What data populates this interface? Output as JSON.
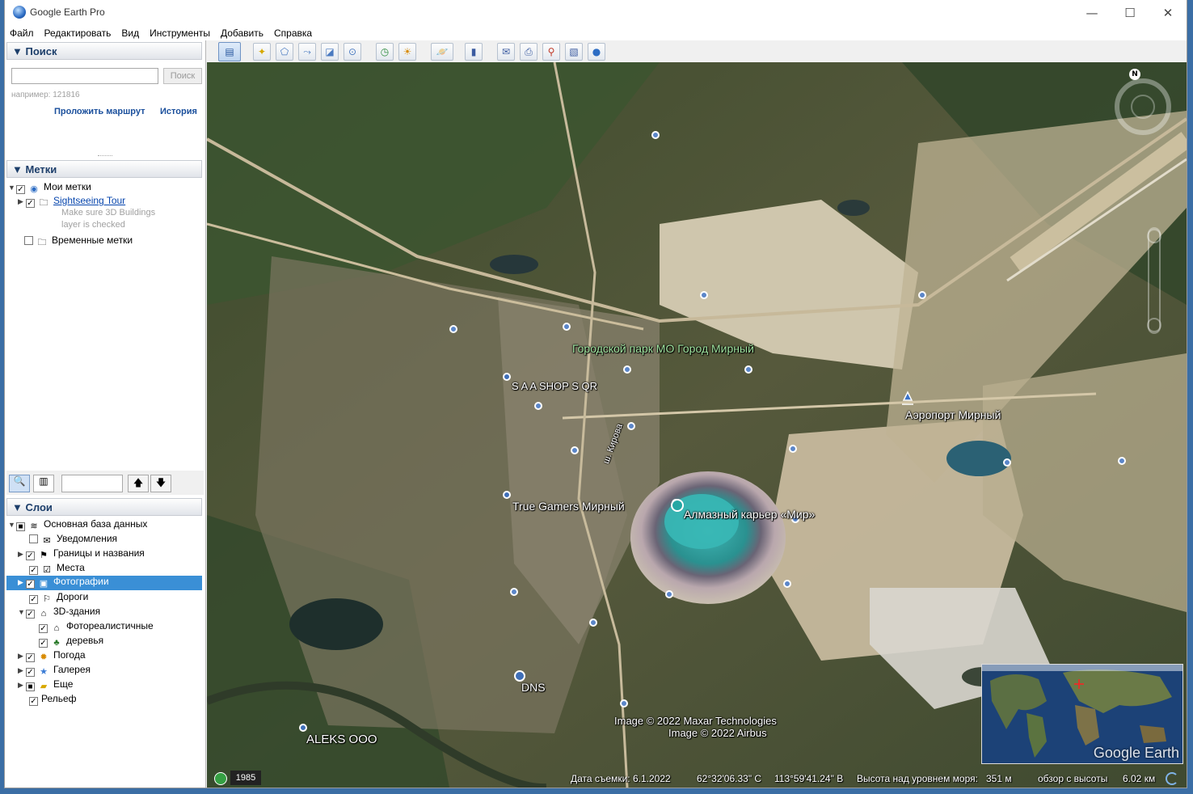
{
  "window": {
    "title": "Google Earth Pro",
    "minimize": "—",
    "maximize": "☐",
    "close": "✕"
  },
  "menu": [
    "Файл",
    "Редактировать",
    "Вид",
    "Инструменты",
    "Добавить",
    "Справка"
  ],
  "search": {
    "header": "Поиск",
    "input_value": "",
    "button": "Поиск",
    "hint": "например: 121816",
    "route_link": "Проложить маршрут",
    "history_link": "История"
  },
  "places": {
    "header": "Метки",
    "items": [
      {
        "label": "Мои метки",
        "checked": true,
        "icon": "globe-icon"
      },
      {
        "label": "Sightseeing Tour",
        "checked": true,
        "icon": "folder-icon",
        "link": true
      },
      {
        "label": "Make sure 3D Buildings",
        "note": true
      },
      {
        "label": "layer is checked",
        "note": true
      },
      {
        "label": "Временные метки",
        "checked": false,
        "icon": "folder-icon"
      }
    ]
  },
  "layers": {
    "header": "Слои",
    "items": [
      {
        "label": "Основная база данных",
        "checked": "partial",
        "icon": "layers-icon"
      },
      {
        "label": "Уведомления",
        "checked": false,
        "icon": "envelope-icon"
      },
      {
        "label": "Границы и названия",
        "checked": true,
        "icon": "flag-icon"
      },
      {
        "label": "Места",
        "checked": true,
        "icon": "places-icon"
      },
      {
        "label": "Фотографии",
        "checked": true,
        "icon": "photo-icon",
        "selected": true
      },
      {
        "label": "Дороги",
        "checked": true,
        "icon": "road-icon"
      },
      {
        "label": "3D-здания",
        "checked": true,
        "icon": "buildings-icon"
      },
      {
        "label": "Фотореалистичные",
        "checked": true,
        "icon": "buildings-icon"
      },
      {
        "label": "деревья",
        "checked": true,
        "icon": "tree-icon"
      },
      {
        "label": "Погода",
        "checked": true,
        "icon": "sun-icon"
      },
      {
        "label": "Галерея",
        "checked": true,
        "icon": "star-icon"
      },
      {
        "label": "Еще",
        "checked": "partial",
        "icon": "folder-icon"
      },
      {
        "label": "Рельеф",
        "checked": true,
        "icon": ""
      }
    ]
  },
  "map_labels": {
    "park": "Городской парк МО Город Мирный",
    "shop": "S A A SHOP S QR",
    "airport": "Аэропорт Мирный",
    "street": "ш. Кирова",
    "gamers": "True Gamers Мирный",
    "quarry": "Алмазный карьер «Мир»",
    "dns": "DNS",
    "aleks": "ALEKS OOO",
    "credit1": "Image © 2022 Maxar Technologies",
    "credit2": "Image © 2022 Airbus",
    "brand": "Google Earth",
    "compass_n": "N"
  },
  "status": {
    "year": "1985",
    "date": "Дата съемки: 6.1.2022",
    "lat": "62°32'06.33\" С",
    "lon": "113°59'41.24\" В",
    "elev_label": "Высота над уровнем моря:",
    "elev": "351 м",
    "eye_label": "обзор с высоты",
    "eye": "6.02 км"
  }
}
